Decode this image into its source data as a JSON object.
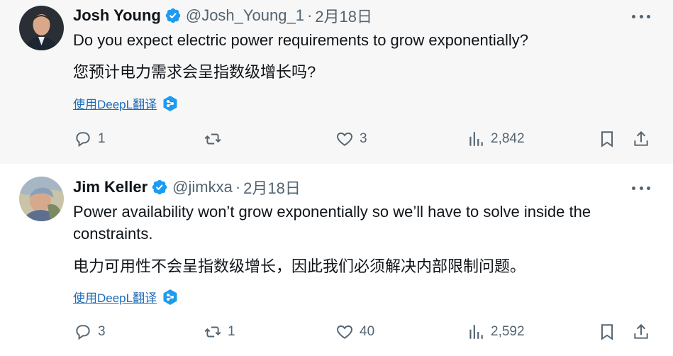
{
  "tweets": [
    {
      "name": "Josh Young",
      "handle": "@Josh_Young_1",
      "separator": "·",
      "date": "2月18日",
      "text_en": "Do you expect electric power requirements to grow exponentially?",
      "text_zh": "您预计电力需求会呈指数级增长吗?",
      "translate_label": "使用DeepL翻译",
      "replies": "1",
      "retweets": "",
      "likes": "3",
      "views": "2,842"
    },
    {
      "name": "Jim Keller",
      "handle": "@jimkxa",
      "separator": "·",
      "date": "2月18日",
      "text_en": "Power availability won’t grow exponentially so we’ll have to solve inside the constraints.",
      "text_zh": "电力可用性不会呈指数级增长，因此我们必须解决内部限制问题。",
      "translate_label": "使用DeepL翻译",
      "replies": "3",
      "retweets": "1",
      "likes": "40",
      "views": "2,592"
    }
  ],
  "colors": {
    "verified": "#1d9bf0",
    "muted": "#536471",
    "link": "#1d6ab8",
    "first_bg": "#f7f7f7"
  }
}
